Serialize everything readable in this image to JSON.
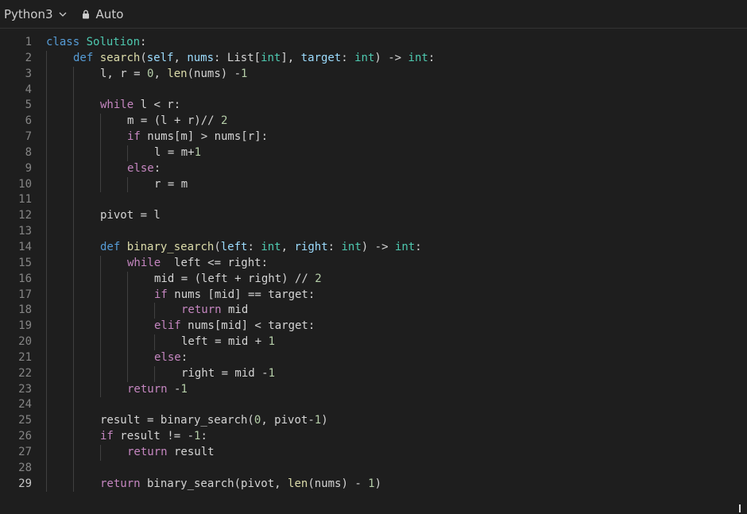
{
  "toolbar": {
    "language": "Python3",
    "mode": "Auto"
  },
  "editor": {
    "active_line": 29,
    "lines": [
      {
        "n": "1",
        "indent": 0,
        "tokens": [
          [
            "kw",
            "class"
          ],
          [
            "pl",
            " "
          ],
          [
            "cls",
            "Solution"
          ],
          [
            "pl",
            ":"
          ]
        ]
      },
      {
        "n": "2",
        "indent": 1,
        "tokens": [
          [
            "kw",
            "def"
          ],
          [
            "pl",
            " "
          ],
          [
            "fn",
            "search"
          ],
          [
            "pl",
            "("
          ],
          [
            "var",
            "self"
          ],
          [
            "pl",
            ", "
          ],
          [
            "var",
            "nums"
          ],
          [
            "pl",
            ": List["
          ],
          [
            "cls",
            "int"
          ],
          [
            "pl",
            "], "
          ],
          [
            "var",
            "target"
          ],
          [
            "pl",
            ": "
          ],
          [
            "cls",
            "int"
          ],
          [
            "pl",
            ") -> "
          ],
          [
            "cls",
            "int"
          ],
          [
            "pl",
            ":"
          ]
        ]
      },
      {
        "n": "3",
        "indent": 2,
        "tokens": [
          [
            "pl",
            "l, r = "
          ],
          [
            "num",
            "0"
          ],
          [
            "pl",
            ", "
          ],
          [
            "bi",
            "len"
          ],
          [
            "pl",
            "(nums) -"
          ],
          [
            "num",
            "1"
          ]
        ]
      },
      {
        "n": "4",
        "indent": 2,
        "tokens": []
      },
      {
        "n": "5",
        "indent": 2,
        "tokens": [
          [
            "kw2",
            "while"
          ],
          [
            "pl",
            " l < r:"
          ]
        ]
      },
      {
        "n": "6",
        "indent": 3,
        "tokens": [
          [
            "pl",
            "m = (l + r)// "
          ],
          [
            "num",
            "2"
          ]
        ]
      },
      {
        "n": "7",
        "indent": 3,
        "tokens": [
          [
            "kw2",
            "if"
          ],
          [
            "pl",
            " nums[m] > nums[r]:"
          ]
        ]
      },
      {
        "n": "8",
        "indent": 4,
        "tokens": [
          [
            "pl",
            "l = m+"
          ],
          [
            "num",
            "1"
          ]
        ]
      },
      {
        "n": "9",
        "indent": 3,
        "tokens": [
          [
            "kw2",
            "else"
          ],
          [
            "pl",
            ":"
          ]
        ]
      },
      {
        "n": "10",
        "indent": 4,
        "tokens": [
          [
            "pl",
            "r = m"
          ]
        ]
      },
      {
        "n": "11",
        "indent": 2,
        "tokens": []
      },
      {
        "n": "12",
        "indent": 2,
        "tokens": [
          [
            "pl",
            "pivot = l"
          ]
        ]
      },
      {
        "n": "13",
        "indent": 2,
        "tokens": []
      },
      {
        "n": "14",
        "indent": 2,
        "tokens": [
          [
            "kw",
            "def"
          ],
          [
            "pl",
            " "
          ],
          [
            "fn",
            "binary_search"
          ],
          [
            "pl",
            "("
          ],
          [
            "var",
            "left"
          ],
          [
            "pl",
            ": "
          ],
          [
            "cls",
            "int"
          ],
          [
            "pl",
            ", "
          ],
          [
            "var",
            "right"
          ],
          [
            "pl",
            ": "
          ],
          [
            "cls",
            "int"
          ],
          [
            "pl",
            ") -> "
          ],
          [
            "cls",
            "int"
          ],
          [
            "pl",
            ":"
          ]
        ]
      },
      {
        "n": "15",
        "indent": 3,
        "tokens": [
          [
            "kw2",
            "while"
          ],
          [
            "pl",
            "  left <= right:"
          ]
        ]
      },
      {
        "n": "16",
        "indent": 4,
        "tokens": [
          [
            "pl",
            "mid = (left + right) // "
          ],
          [
            "num",
            "2"
          ]
        ]
      },
      {
        "n": "17",
        "indent": 4,
        "tokens": [
          [
            "kw2",
            "if"
          ],
          [
            "pl",
            " nums [mid] == target:"
          ]
        ]
      },
      {
        "n": "18",
        "indent": 5,
        "tokens": [
          [
            "kw2",
            "return"
          ],
          [
            "pl",
            " mid"
          ]
        ]
      },
      {
        "n": "19",
        "indent": 4,
        "tokens": [
          [
            "kw2",
            "elif"
          ],
          [
            "pl",
            " nums[mid] < target:"
          ]
        ]
      },
      {
        "n": "20",
        "indent": 5,
        "tokens": [
          [
            "pl",
            "left = mid + "
          ],
          [
            "num",
            "1"
          ]
        ]
      },
      {
        "n": "21",
        "indent": 4,
        "tokens": [
          [
            "kw2",
            "else"
          ],
          [
            "pl",
            ":"
          ]
        ]
      },
      {
        "n": "22",
        "indent": 5,
        "tokens": [
          [
            "pl",
            "right = mid -"
          ],
          [
            "num",
            "1"
          ]
        ]
      },
      {
        "n": "23",
        "indent": 3,
        "tokens": [
          [
            "kw2",
            "return"
          ],
          [
            "pl",
            " -"
          ],
          [
            "num",
            "1"
          ]
        ]
      },
      {
        "n": "24",
        "indent": 2,
        "tokens": []
      },
      {
        "n": "25",
        "indent": 2,
        "tokens": [
          [
            "pl",
            "result = binary_search("
          ],
          [
            "num",
            "0"
          ],
          [
            "pl",
            ", pivot-"
          ],
          [
            "num",
            "1"
          ],
          [
            "pl",
            ")"
          ]
        ]
      },
      {
        "n": "26",
        "indent": 2,
        "tokens": [
          [
            "kw2",
            "if"
          ],
          [
            "pl",
            " result != -"
          ],
          [
            "num",
            "1"
          ],
          [
            "pl",
            ":"
          ]
        ]
      },
      {
        "n": "27",
        "indent": 3,
        "tokens": [
          [
            "kw2",
            "return"
          ],
          [
            "pl",
            " result"
          ]
        ]
      },
      {
        "n": "28",
        "indent": 2,
        "tokens": []
      },
      {
        "n": "29",
        "indent": 2,
        "tokens": [
          [
            "kw2",
            "return"
          ],
          [
            "pl",
            " binary_search(pivot, "
          ],
          [
            "bi",
            "len"
          ],
          [
            "pl",
            "(nums) - "
          ],
          [
            "num",
            "1"
          ],
          [
            "pl",
            ")"
          ]
        ]
      }
    ]
  }
}
